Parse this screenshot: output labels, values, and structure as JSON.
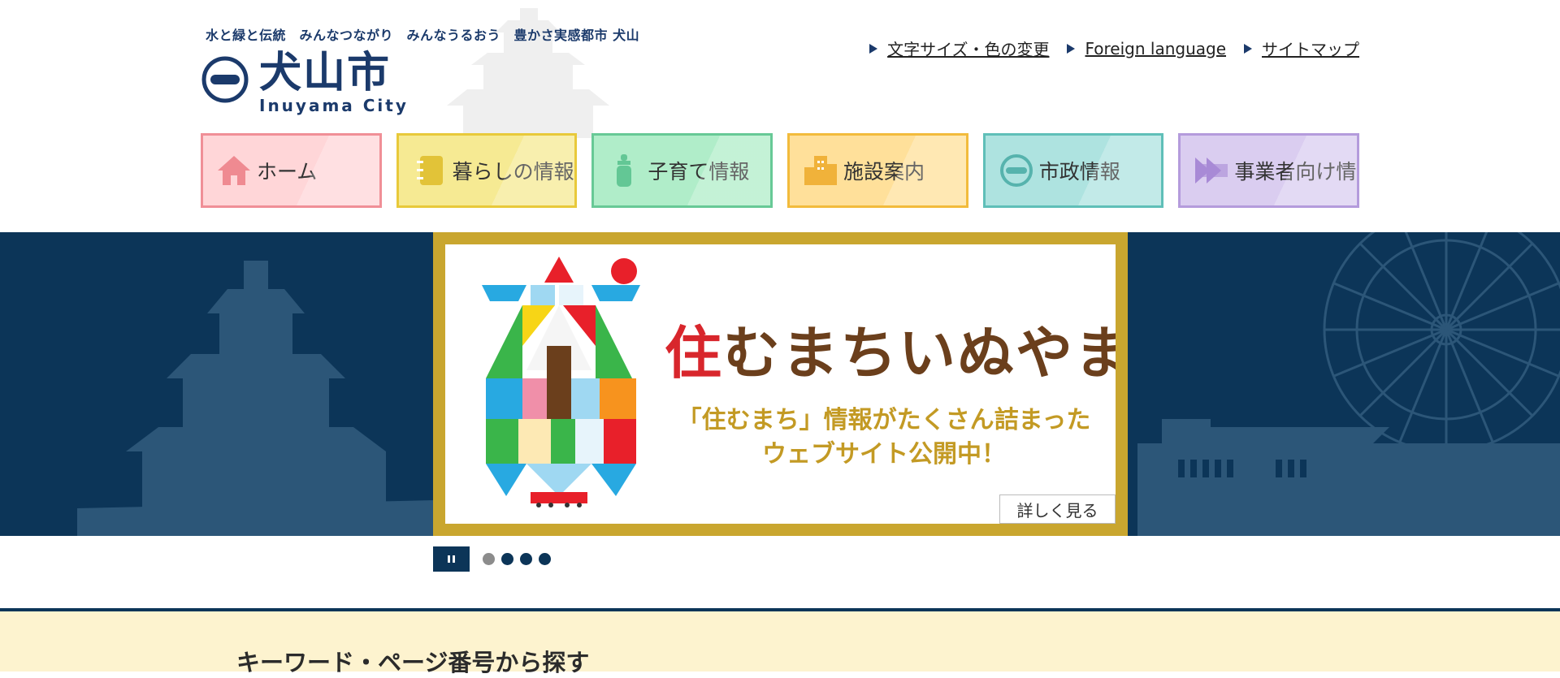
{
  "header": {
    "tagline": "水と緑と伝統　みんなつながり　みんなうるおう　豊かさ実感都市 犬山",
    "logo_jp": "犬山市",
    "logo_en": "Inuyama City"
  },
  "util_links": [
    {
      "label": "文字サイズ・色の変更"
    },
    {
      "label": "Foreign language"
    },
    {
      "label": "サイトマップ"
    }
  ],
  "global_nav": [
    {
      "label": "ホーム",
      "icon": "home-icon",
      "bg": "#ffd6d8",
      "border": "#f08f97",
      "icon_color": "#ef8a91"
    },
    {
      "label": "暮らしの情報",
      "icon": "notebook-icon",
      "bg": "#f6ea93",
      "border": "#e8c93a",
      "icon_color": "#e2c338"
    },
    {
      "label": "子育て情報",
      "icon": "baby-bottle-icon",
      "bg": "#b0edc9",
      "border": "#67c996",
      "icon_color": "#63c795"
    },
    {
      "label": "施設案内",
      "icon": "buildings-icon",
      "bg": "#ffe09a",
      "border": "#f2bb3c",
      "icon_color": "#f0b23a"
    },
    {
      "label": "市政情報",
      "icon": "city-emblem-icon",
      "bg": "#aee3e0",
      "border": "#5fbfb8",
      "icon_color": "#56b3ad"
    },
    {
      "label": "事業者向け情報",
      "icon": "arrows-icon",
      "bg": "#dacdf0",
      "border": "#b49bdc",
      "icon_color": "#a88ad6"
    }
  ],
  "slider": {
    "title_red": "住",
    "title_rest": "むまちいぬやま",
    "subtitle_line1": "「住むまち」情報がたくさん詰まった",
    "subtitle_line2": "ウェブサイト公開中！",
    "more_label": "詳しく見る",
    "slide_count": 4,
    "active_index": 0
  },
  "search": {
    "title": "キーワード・ページ番号から探す"
  },
  "colors": {
    "navy": "#0c3558",
    "gold": "#c9a62f",
    "search_bg": "#fdf3cf"
  }
}
